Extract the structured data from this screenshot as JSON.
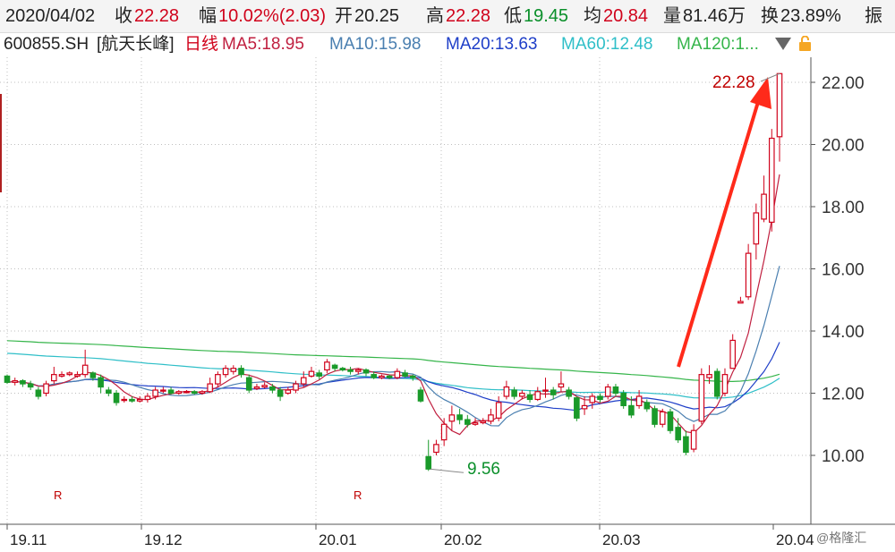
{
  "header": {
    "date": "2020/04/02",
    "close_label": "收",
    "close_value": "22.28",
    "change_label": "幅",
    "change_value": "10.02%(2.03)",
    "open_label": "开",
    "open_value": "20.25",
    "high_label": "高",
    "high_value": "22.28",
    "low_label": "低",
    "low_value": "19.45",
    "avg_label": "均",
    "avg_value": "20.84",
    "volume_label": "量",
    "volume_value": "81.46万",
    "turnover_label": "换",
    "turnover_value": "23.89%",
    "amplitude_label": "振"
  },
  "ma_bar": {
    "code": "600855.SH",
    "name": "[航天长峰]",
    "period": "日线",
    "ma5": "MA5:18.95",
    "ma10": "MA10:15.98",
    "ma20": "MA20:13.63",
    "ma60": "MA60:12.48",
    "ma120": "MA120:1..."
  },
  "annotations": {
    "high_label": "22.28",
    "low_label": "9.56",
    "marker_r1": "R",
    "marker_r2": "R"
  },
  "watermark": "@格隆汇",
  "colors": {
    "up": "#d0021b",
    "down": "#1a9a2a",
    "ma5": "#c02040",
    "ma10": "#4a7fb0",
    "ma20": "#1e3ec8",
    "ma60": "#2fbfc8",
    "ma120": "#35b54a",
    "arrow": "#ff2a1a"
  },
  "chart_data": {
    "type": "candlestick",
    "title": "600855.SH [航天长峰] 日线",
    "y_ticks": [
      "10.00",
      "12.00",
      "14.00",
      "16.00",
      "18.00",
      "20.00",
      "22.00"
    ],
    "ylim": [
      9.0,
      23.0
    ],
    "x_ticks": [
      "19.11",
      "19.12",
      "20.01",
      "20.02",
      "20.03",
      "20.04"
    ],
    "grid": true,
    "candles": [
      [
        12.55,
        12.35,
        12.6,
        12.3
      ],
      [
        12.35,
        12.4,
        12.5,
        12.25
      ],
      [
        12.4,
        12.3,
        12.45,
        12.2
      ],
      [
        12.3,
        12.2,
        12.4,
        12.1
      ],
      [
        12.1,
        11.9,
        12.2,
        11.8
      ],
      [
        12.0,
        12.3,
        12.4,
        11.9
      ],
      [
        12.4,
        12.6,
        12.85,
        12.3
      ],
      [
        12.55,
        12.6,
        12.7,
        12.5
      ],
      [
        12.6,
        12.65,
        12.7,
        12.55
      ],
      [
        12.55,
        12.6,
        12.7,
        12.5
      ],
      [
        12.6,
        12.9,
        13.4,
        12.5
      ],
      [
        12.65,
        12.5,
        12.7,
        12.4
      ],
      [
        12.5,
        12.2,
        12.6,
        12.0
      ],
      [
        12.1,
        12.0,
        12.2,
        11.9
      ],
      [
        12.0,
        11.7,
        12.1,
        11.6
      ],
      [
        11.8,
        11.8,
        11.9,
        11.7
      ],
      [
        11.8,
        11.75,
        11.9,
        11.7
      ],
      [
        11.75,
        11.8,
        11.9,
        11.7
      ],
      [
        11.8,
        11.9,
        12.0,
        11.7
      ],
      [
        11.9,
        12.1,
        12.2,
        11.8
      ],
      [
        12.1,
        12.1,
        12.2,
        12.0
      ],
      [
        12.1,
        12.0,
        12.2,
        11.95
      ],
      [
        12.0,
        12.05,
        12.1,
        11.95
      ],
      [
        12.05,
        12.05,
        12.1,
        12.0
      ],
      [
        12.05,
        12.0,
        12.1,
        11.95
      ],
      [
        12.0,
        12.05,
        12.1,
        11.95
      ],
      [
        12.05,
        12.3,
        12.5,
        12.0
      ],
      [
        12.3,
        12.6,
        12.7,
        12.2
      ],
      [
        12.6,
        12.8,
        12.9,
        12.5
      ],
      [
        12.7,
        12.8,
        12.9,
        12.6
      ],
      [
        12.8,
        12.6,
        12.9,
        12.5
      ],
      [
        12.5,
        12.1,
        12.6,
        12.0
      ],
      [
        12.15,
        12.2,
        12.3,
        12.1
      ],
      [
        12.2,
        12.25,
        12.35,
        12.15
      ],
      [
        12.2,
        12.1,
        12.3,
        12.0
      ],
      [
        12.1,
        11.9,
        12.2,
        11.75
      ],
      [
        12.0,
        12.1,
        12.2,
        11.95
      ],
      [
        12.1,
        12.3,
        12.4,
        12.0
      ],
      [
        12.3,
        12.5,
        12.7,
        12.2
      ],
      [
        12.55,
        12.7,
        12.85,
        12.5
      ],
      [
        12.65,
        12.55,
        12.75,
        12.45
      ],
      [
        12.75,
        13.0,
        13.1,
        12.65
      ],
      [
        12.9,
        12.8,
        12.95,
        12.7
      ],
      [
        12.8,
        12.75,
        12.85,
        12.7
      ],
      [
        12.75,
        12.7,
        12.85,
        12.6
      ],
      [
        12.7,
        12.75,
        12.8,
        12.6
      ],
      [
        12.75,
        12.65,
        12.8,
        12.55
      ],
      [
        12.6,
        12.5,
        12.7,
        12.45
      ],
      [
        12.5,
        12.55,
        12.6,
        12.45
      ],
      [
        12.55,
        12.5,
        12.6,
        12.45
      ],
      [
        12.5,
        12.7,
        12.8,
        12.45
      ],
      [
        12.65,
        12.55,
        12.75,
        12.5
      ],
      [
        12.55,
        12.5,
        12.6,
        12.4
      ],
      [
        12.1,
        11.75,
        12.2,
        11.7
      ],
      [
        9.96,
        9.56,
        10.5,
        9.5
      ],
      [
        10.1,
        10.35,
        10.5,
        10.0
      ],
      [
        10.5,
        11.0,
        11.2,
        10.3
      ],
      [
        11.1,
        11.3,
        11.6,
        10.8
      ],
      [
        11.3,
        11.15,
        11.5,
        11.0
      ],
      [
        11.15,
        11.0,
        11.3,
        10.9
      ],
      [
        11.0,
        11.05,
        11.2,
        10.95
      ],
      [
        11.05,
        11.1,
        11.2,
        11.0
      ],
      [
        11.1,
        11.3,
        11.5,
        11.0
      ],
      [
        11.2,
        11.7,
        11.9,
        11.1
      ],
      [
        11.9,
        12.2,
        12.4,
        11.8
      ],
      [
        12.1,
        11.9,
        12.2,
        11.8
      ],
      [
        11.9,
        12.0,
        12.1,
        11.8
      ],
      [
        11.95,
        11.8,
        12.1,
        11.7
      ],
      [
        11.8,
        12.05,
        12.2,
        11.75
      ],
      [
        12.1,
        12.1,
        12.5,
        11.85
      ],
      [
        12.1,
        11.95,
        12.2,
        11.8
      ],
      [
        12.2,
        12.3,
        12.7,
        12.05
      ],
      [
        12.1,
        11.9,
        12.2,
        11.8
      ],
      [
        11.85,
        11.2,
        11.9,
        11.1
      ],
      [
        11.5,
        11.6,
        11.9,
        11.3
      ],
      [
        11.7,
        11.9,
        12.0,
        11.5
      ],
      [
        11.9,
        11.8,
        12.0,
        11.7
      ],
      [
        11.9,
        12.2,
        12.3,
        11.8
      ],
      [
        12.2,
        12.0,
        12.3,
        11.9
      ],
      [
        12.0,
        11.6,
        12.1,
        11.5
      ],
      [
        11.6,
        11.3,
        11.9,
        11.2
      ],
      [
        11.6,
        11.9,
        12.1,
        11.5
      ],
      [
        11.7,
        11.5,
        11.8,
        11.4
      ],
      [
        11.5,
        11.0,
        11.6,
        10.9
      ],
      [
        11.0,
        11.4,
        11.5,
        10.9
      ],
      [
        11.4,
        10.8,
        11.5,
        10.7
      ],
      [
        10.9,
        10.5,
        11.2,
        10.4
      ],
      [
        10.6,
        10.1,
        10.8,
        10.0
      ],
      [
        10.2,
        10.8,
        11.0,
        10.1
      ],
      [
        11.1,
        12.6,
        12.8,
        11.0
      ],
      [
        12.5,
        12.6,
        12.9,
        12.3
      ],
      [
        12.7,
        11.9,
        12.8,
        11.8
      ],
      [
        12.0,
        12.6,
        12.8,
        11.9
      ],
      [
        12.8,
        13.7,
        13.9,
        12.8
      ],
      [
        14.9,
        14.95,
        15.1,
        14.9
      ],
      [
        15.1,
        16.5,
        16.8,
        15.0
      ],
      [
        16.8,
        17.8,
        18.1,
        16.3
      ],
      [
        17.6,
        18.4,
        19.0,
        17.5
      ],
      [
        17.5,
        20.2,
        20.5,
        17.2
      ],
      [
        20.25,
        22.28,
        22.28,
        19.45
      ]
    ],
    "annotations": [
      {
        "label": "22.28",
        "note": "high"
      },
      {
        "label": "9.56",
        "note": "low"
      }
    ]
  }
}
